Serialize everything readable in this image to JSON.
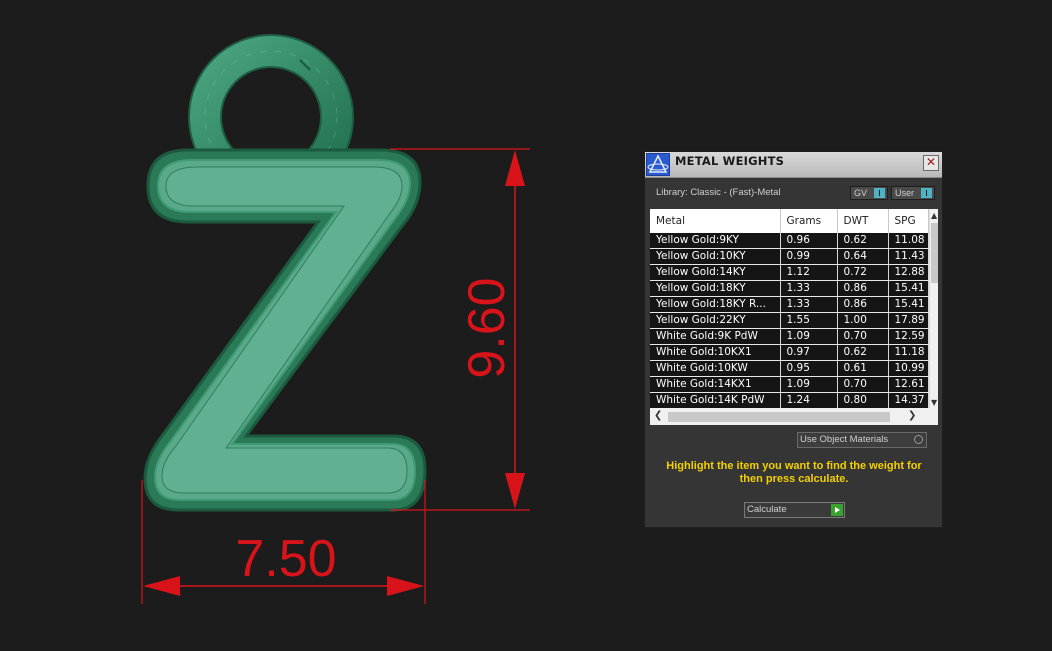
{
  "viewport": {
    "dimension_width": "7.50",
    "dimension_height": "9.60"
  },
  "panel": {
    "title": "METAL WEIGHTS",
    "close_glyph": "✕",
    "library_label": "Library: Classic - (Fast)-Metal",
    "gv_toggle": "GV",
    "user_toggle": "User",
    "columns": [
      "Metal",
      "Grams",
      "DWT",
      "SPG"
    ],
    "rows": [
      [
        "Yellow Gold:9KY",
        "0.96",
        "0.62",
        "11.08"
      ],
      [
        "Yellow Gold:10KY",
        "0.99",
        "0.64",
        "11.43"
      ],
      [
        "Yellow Gold:14KY",
        "1.12",
        "0.72",
        "12.88"
      ],
      [
        "Yellow Gold:18KY",
        "1.33",
        "0.86",
        "15.41"
      ],
      [
        "Yellow Gold:18KY R...",
        "1.33",
        "0.86",
        "15.41"
      ],
      [
        "Yellow Gold:22KY",
        "1.55",
        "1.00",
        "17.89"
      ],
      [
        "White Gold:9K PdW",
        "1.09",
        "0.70",
        "12.59"
      ],
      [
        "White Gold:10KX1",
        "0.97",
        "0.62",
        "11.18"
      ],
      [
        "White Gold:10KW",
        "0.95",
        "0.61",
        "10.99"
      ],
      [
        "White Gold:14KX1",
        "1.09",
        "0.70",
        "12.61"
      ],
      [
        "White Gold:14K PdW",
        "1.24",
        "0.80",
        "14.37"
      ]
    ],
    "use_object_materials": "Use Object Materials",
    "instructions": "Highlight the item you want to find the weight for then press calculate.",
    "calculate_label": "Calculate"
  },
  "colors": {
    "background": "#1c1c1c",
    "pendant_fill": "#5aaa8a",
    "pendant_edge": "#2f8060",
    "dimension_red": "#d8141a",
    "instruction_yellow": "#f3d000"
  }
}
